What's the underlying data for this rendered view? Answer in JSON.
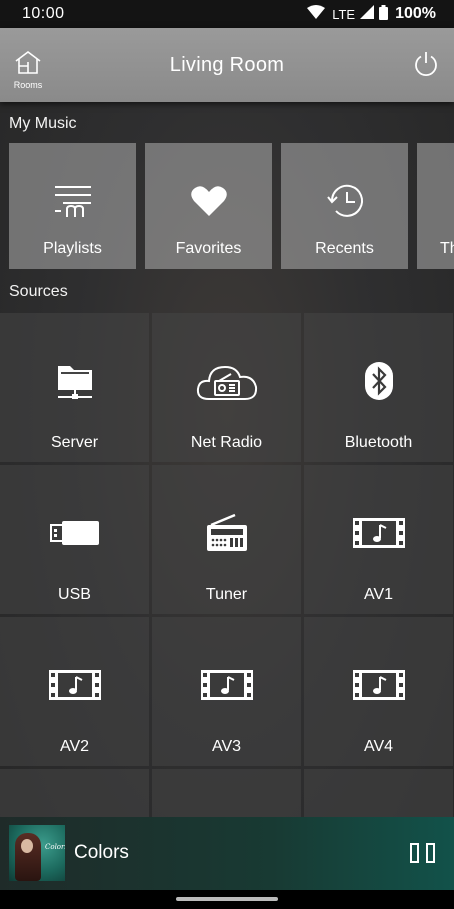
{
  "status_bar": {
    "time": "10:00",
    "network": "LTE",
    "battery": "100%"
  },
  "header": {
    "title": "Living Room",
    "rooms_label": "Rooms"
  },
  "my_music": {
    "label": "My Music",
    "items": [
      {
        "label": "Playlists",
        "icon": "playlist-icon"
      },
      {
        "label": "Favorites",
        "icon": "heart-icon"
      },
      {
        "label": "Recents",
        "icon": "history-clock-icon"
      },
      {
        "label": "Th",
        "icon": "unknown-icon"
      }
    ]
  },
  "sources": {
    "label": "Sources",
    "items": [
      {
        "label": "Server",
        "icon": "folder-server-icon"
      },
      {
        "label": "Net Radio",
        "icon": "cloud-radio-icon"
      },
      {
        "label": "Bluetooth",
        "icon": "bluetooth-icon"
      },
      {
        "label": "USB",
        "icon": "usb-icon"
      },
      {
        "label": "Tuner",
        "icon": "radio-icon"
      },
      {
        "label": "AV1",
        "icon": "film-music-icon"
      },
      {
        "label": "AV2",
        "icon": "film-music-icon"
      },
      {
        "label": "AV3",
        "icon": "film-music-icon"
      },
      {
        "label": "AV4",
        "icon": "film-music-icon"
      }
    ]
  },
  "now_playing": {
    "title": "Colors",
    "album_art_text": "Colors"
  },
  "colors": {
    "header_bg": "#8f8f8f",
    "now_playing_accent": "#12524a"
  }
}
